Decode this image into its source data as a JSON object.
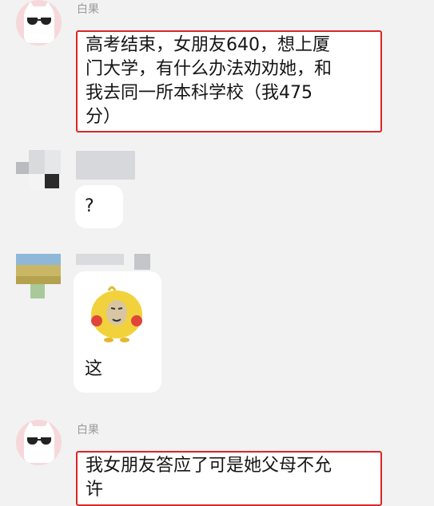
{
  "messages": [
    {
      "sender_name": "白果",
      "lines": [
        "高考结束，女朋友640，想上厦",
        "门大学，有什么办法劝劝她，和",
        "我去同一所本科学校（我475",
        "分）"
      ]
    },
    {
      "text": "?"
    },
    {
      "sticker_name": "yellow-blob-meme-sticker",
      "text": "这"
    },
    {
      "sender_name": "白果",
      "lines": [
        "我女朋友答应了可是她父母不允",
        "许"
      ]
    }
  ],
  "colors": {
    "background": "#f2f2f2",
    "highlight_border": "#d8262a",
    "avatar_pink": "#f6d8db",
    "sticker_yellow": "#f2d23c"
  },
  "icons": [
    "cat-sunglasses-avatar-icon",
    "pixelated-avatar-icon",
    "yellow-blob-meme-sticker"
  ]
}
